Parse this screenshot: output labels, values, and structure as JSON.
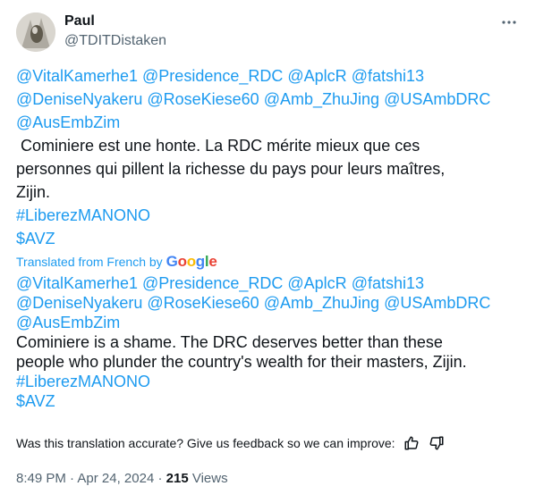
{
  "author": {
    "name": "Paul",
    "handle": "@TDITDistaken"
  },
  "original": {
    "mentions_line1": [
      "@VitalKamerhe1",
      "@Presidence_RDC",
      "@AplcR",
      "@fatshi13"
    ],
    "mentions_line2": [
      "@DeniseNyakeru",
      "@RoseKiese60",
      "@Amb_ZhuJing",
      "@USAmbDRC"
    ],
    "mentions_line3": [
      "@AusEmbZim"
    ],
    "text_line1": " Cominiere est une honte. La RDC mérite mieux que ces",
    "text_line2": "personnes qui pillent la richesse du pays pour leurs maîtres,",
    "text_line3": "Zijin.",
    "hashtag": "#LiberezMANONO",
    "cashtag": "$AVZ"
  },
  "translation_label": "Translated from French by",
  "google_brand": [
    "G",
    "o",
    "o",
    "g",
    "l",
    "e"
  ],
  "translated": {
    "mentions_line1": [
      "@VitalKamerhe1",
      "@Presidence_RDC",
      "@AplcR",
      "@fatshi13"
    ],
    "mentions_line2": [
      "@DeniseNyakeru",
      "@RoseKiese60",
      "@Amb_ZhuJing",
      "@USAmbDRC"
    ],
    "mentions_line3": [
      "@AusEmbZim"
    ],
    "text_line1": "Cominiere is a shame. The DRC deserves better than these",
    "text_line2": "people who plunder the country's wealth for their masters, Zijin.",
    "hashtag": "#LiberezMANONO",
    "cashtag": "$AVZ"
  },
  "feedback_prompt": "Was this translation accurate? Give us feedback so we can improve:",
  "meta": {
    "time": "8:49 PM",
    "sep1": " · ",
    "date": "Apr 24, 2024",
    "sep2": " · ",
    "views_count": "215",
    "views_label": " Views"
  },
  "icons": {
    "more": "more-icon",
    "thumbs_up": "thumbs-up-icon",
    "thumbs_down": "thumbs-down-icon"
  },
  "colors": {
    "link": "#1d9bf0",
    "text": "#0f1419",
    "secondary": "#536471"
  }
}
